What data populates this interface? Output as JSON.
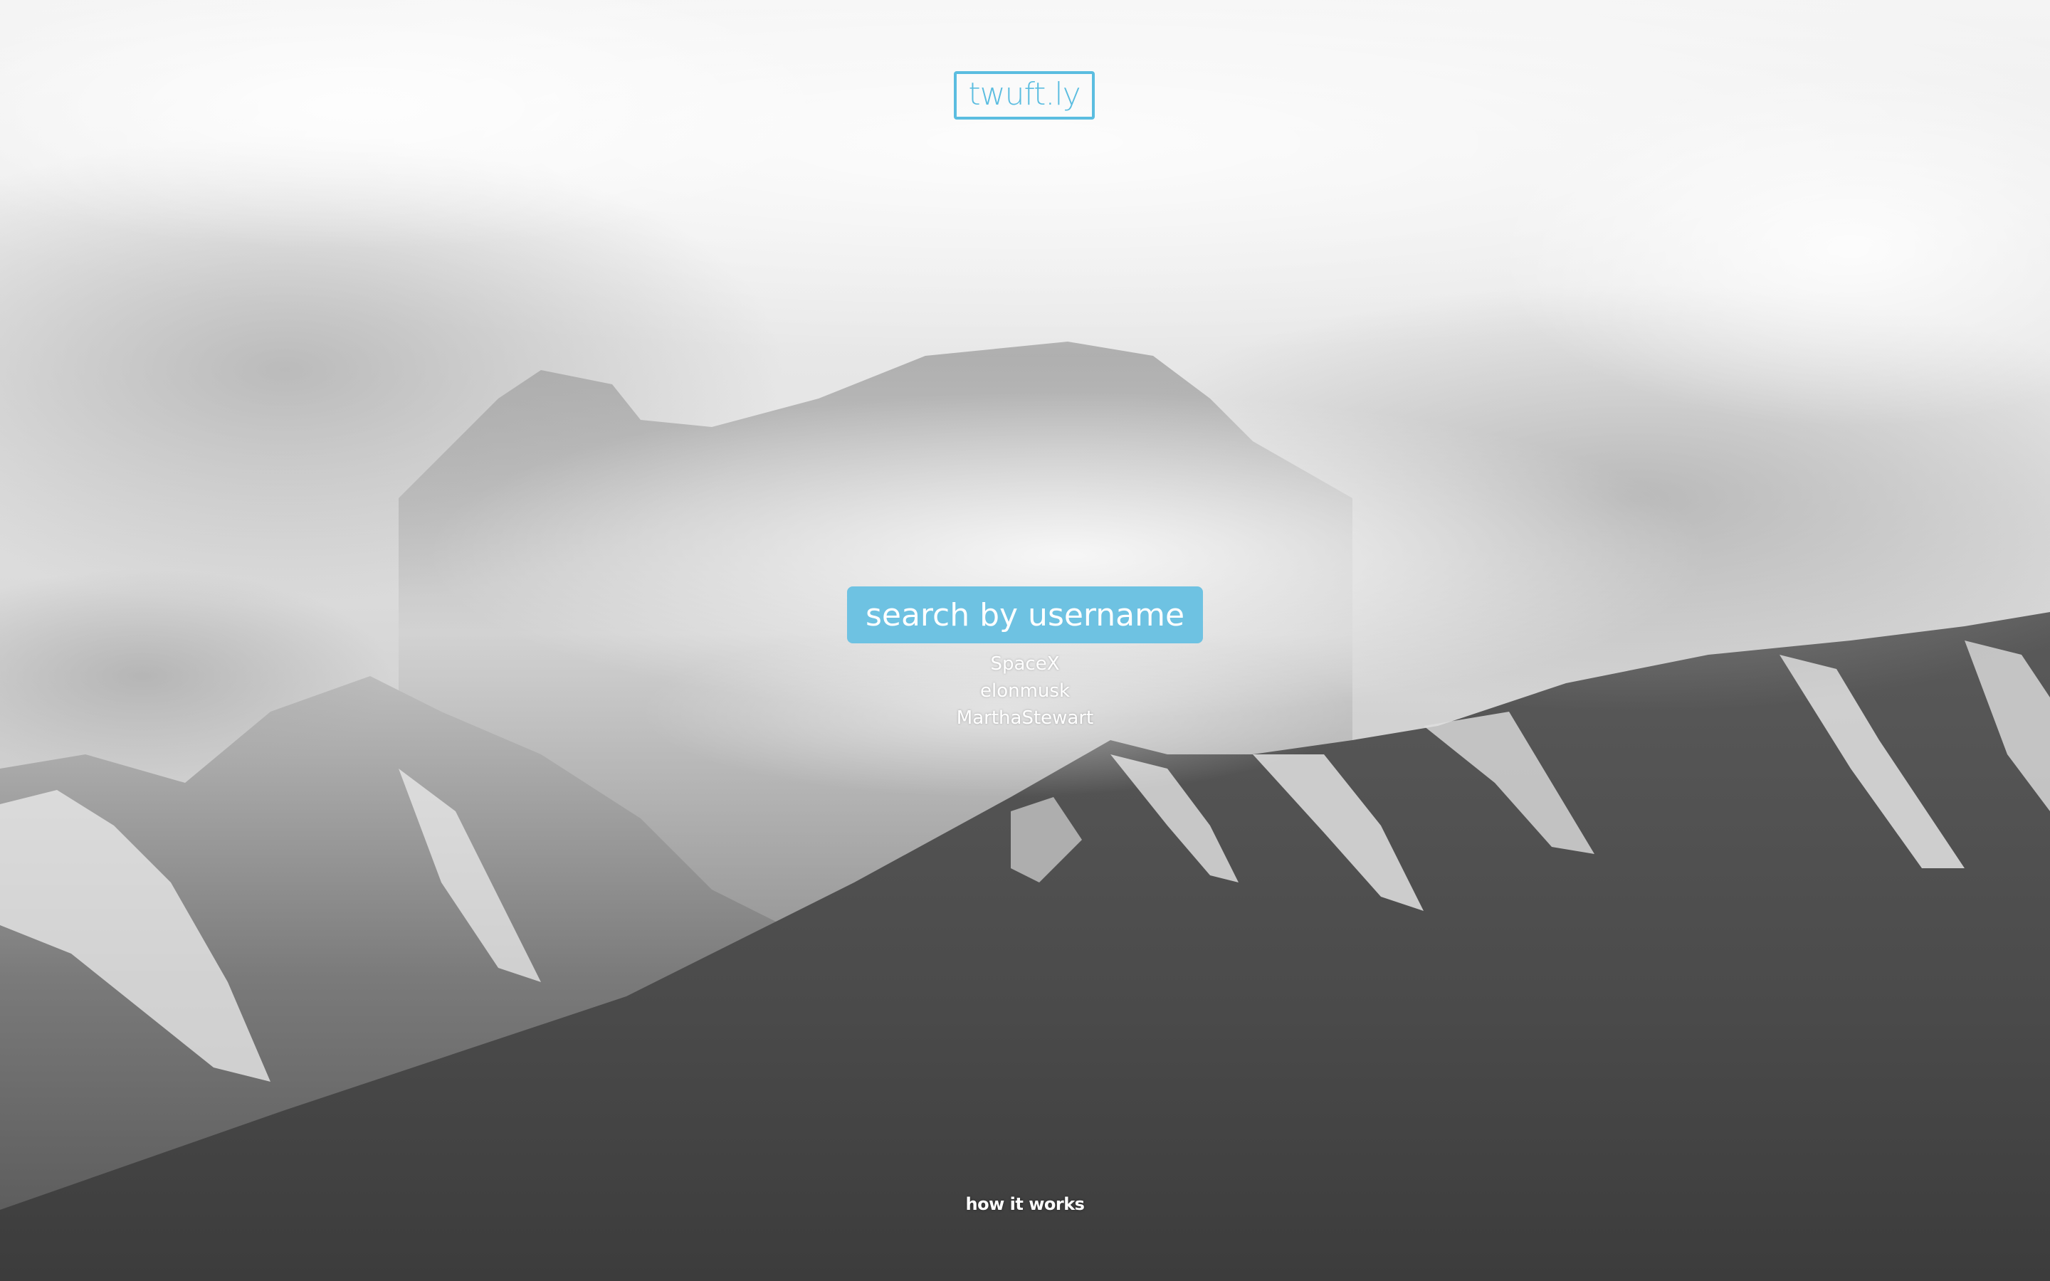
{
  "header": {
    "logo_text": "twuft.ly"
  },
  "search": {
    "placeholder": "search by username",
    "value": ""
  },
  "suggestions": [
    "SpaceX",
    "elonmusk",
    "MarthaStewart"
  ],
  "footer": {
    "how_it_works": "how it works"
  },
  "colors": {
    "accent": "#5bbde0",
    "search_bg": "#6ec2e2",
    "text_light": "#ffffff"
  }
}
